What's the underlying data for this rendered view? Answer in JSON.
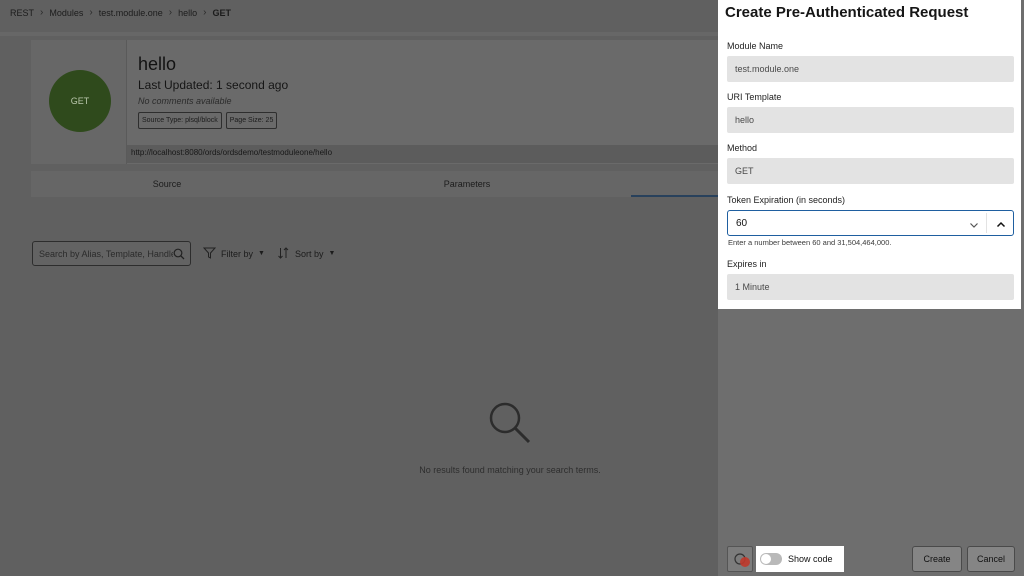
{
  "breadcrumb": {
    "items": [
      "REST",
      "Modules",
      "test.module.one",
      "hello"
    ],
    "current": "GET",
    "separator": "›"
  },
  "handler_card": {
    "avatar_text": "GET",
    "title": "hello",
    "last_updated": "Last Updated: 1 second ago",
    "comments": "No comments available",
    "chips": [
      "Source Type: plsql/block",
      "Page Size: 25"
    ],
    "url": "http://localhost:8080/ords/ordsdemo/testmoduleone/hello"
  },
  "tabs": [
    {
      "label": "Source"
    },
    {
      "label": "Parameters"
    },
    {
      "label": ""
    }
  ],
  "toolbar": {
    "search_placeholder": "Search by Alias, Template, Handler",
    "filter_label": "Filter by",
    "sort_label": "Sort by"
  },
  "empty_state": {
    "message": "No results found matching your search terms."
  },
  "panel": {
    "title": "Create Pre-Authenticated Request",
    "fields": {
      "module_name": {
        "label": "Module Name",
        "value": "test.module.one"
      },
      "uri_template": {
        "label": "URI Template",
        "value": "hello"
      },
      "method": {
        "label": "Method",
        "value": "GET"
      },
      "token_expiration": {
        "label": "Token Expiration (in seconds)",
        "value": "60",
        "hint": "Enter a number between 60 and 31,504,464,000."
      },
      "expires_in": {
        "label": "Expires in",
        "value": "1 Minute"
      }
    },
    "show_code_label": "Show code",
    "show_code_on": false,
    "create_label": "Create",
    "cancel_label": "Cancel"
  },
  "colors": {
    "accent": "#1f5fa0",
    "avatar_bg": "#2f4a1c",
    "overlay": "#606060"
  }
}
